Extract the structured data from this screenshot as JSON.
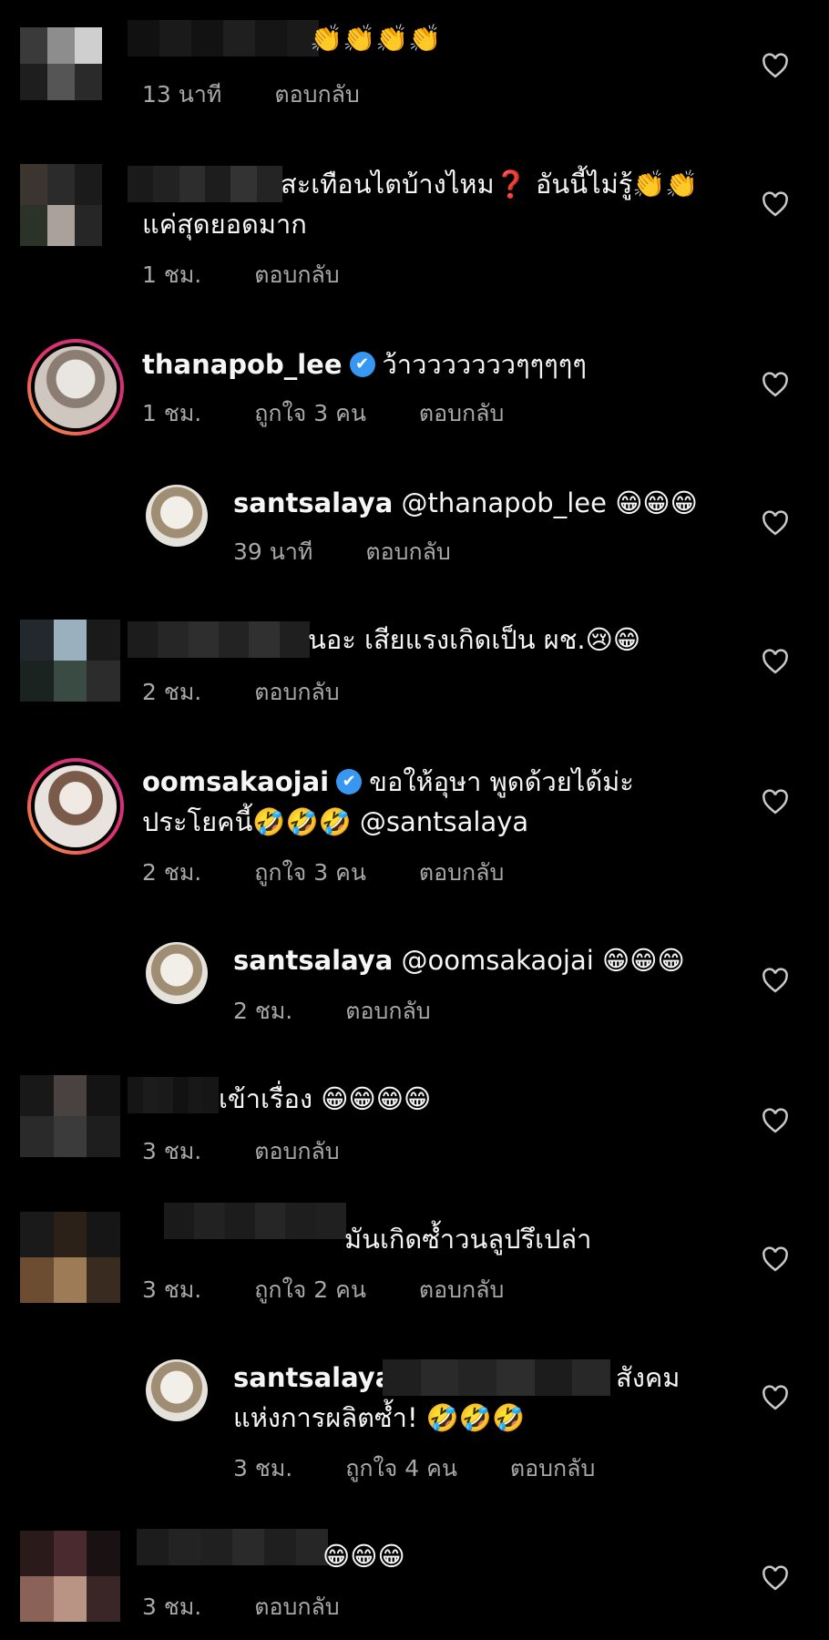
{
  "comments": [
    {
      "text": "👏👏👏👏",
      "time": "13 นาที",
      "reply": "ตอบกลับ"
    },
    {
      "text_line1": "สะเทือนไตบ้างไหม❓ อันนี้ไม่รู้👏👏",
      "text_line2": "แค่สุดยอดมาก",
      "time": "1 ชม.",
      "reply": "ตอบกลับ"
    },
    {
      "username": "thanapob_lee",
      "verified": "✔",
      "text": "ว้าวววววววๆๆๆๆๆ",
      "time": "1 ชม.",
      "likes": "ถูกใจ 3 คน",
      "reply": "ตอบกลับ"
    },
    {
      "username": "santsalaya",
      "mention": "@thanapob_lee",
      "text": "😁😁😁",
      "time": "39 นาที",
      "reply": "ตอบกลับ"
    },
    {
      "text": "นอะ เสียแรงเกิดเป็น ผช.😢😁",
      "time": "2 ชม.",
      "reply": "ตอบกลับ"
    },
    {
      "username": "oomsakaojai",
      "verified": "✔",
      "text": "ขอให้อุษา พูดด้วยได้ม่ะ",
      "text_line2": "ประโยคนี้🤣🤣🤣 @santsalaya",
      "time": "2 ชม.",
      "likes": "ถูกใจ 3 คน",
      "reply": "ตอบกลับ"
    },
    {
      "username": "santsalaya",
      "mention": "@oomsakaojai",
      "text": "😁😁😁",
      "time": "2 ชม.",
      "reply": "ตอบกลับ"
    },
    {
      "text": "เข้าเรื่อง 😁😁😁😁",
      "time": "3 ชม.",
      "reply": "ตอบกลับ"
    },
    {
      "text": "มันเกิดซ้ำวนลูปรึเปล่า",
      "time": "3 ชม.",
      "likes": "ถูกใจ 2 คน",
      "reply": "ตอบกลับ"
    },
    {
      "username": "santsalaya",
      "text_end": "สังคม",
      "text_line2": "แห่งการผลิตซ้ำ! 🤣🤣🤣",
      "time": "3 ชม.",
      "likes": "ถูกใจ 4 คน",
      "reply": "ตอบกลับ"
    },
    {
      "text": "😁😁😁",
      "time": "3 ชม.",
      "reply": "ตอบกลับ"
    }
  ],
  "icons": {
    "like": "heart-outline-icon",
    "verified": "verified-badge-icon"
  },
  "colors": {
    "background": "#000000",
    "text": "#f5f5f5",
    "meta": "#a8a8a8",
    "verified": "#3897f0"
  }
}
